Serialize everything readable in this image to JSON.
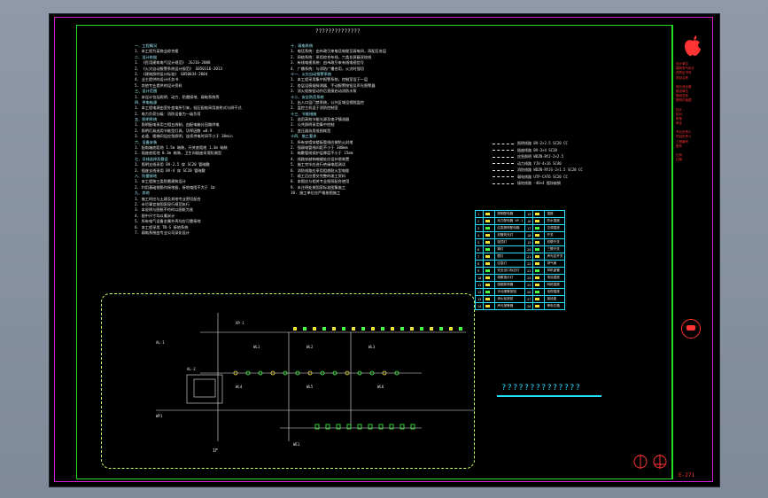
{
  "drawing": {
    "title": "??????????????",
    "sub_title": "??????????????",
    "scale_mark": "1F",
    "sheet_number": "E-271",
    "stamp_text": "TBD"
  },
  "notes_left": [
    "一、工程概况",
    "1. 本工程为某商业综合楼",
    "二、设计依据",
    "1. 《民用建筑电气设计规范》 JGJ16-2008",
    "2. 《火灾自动报警系统设计规范》 GB50116-2013",
    "3. 《建筑照明设计标准》 GB50034-2004",
    "4. 业主提供的设计任务书",
    "5. 其他专业提供的设计资料",
    "三、设计范围",
    "1. 本设计包括照明、动力、防雷接地、弱电系统等",
    "四、供电电源",
    "1. 本工程电源由室外变电所引来，低压配电采用放射式与树干式",
    "2. 电力负荷分级：消防设备为一级负荷",
    "五、照明系统",
    "1. 照明配电采用三相五线制，由配电箱分回路供电",
    "2. 照明灯具选用节能型灯具，功率因数 ≥0.9",
    "3. 走道、楼梯间设应急照明，连续供电时间不小于 30min",
    "六、设备安装",
    "1. 配电箱底距地 1.5m 暗装，开关底距地 1.3m 暗装",
    "2. 插座底距地 0.3m 暗装，卫生间插座采用防溅型",
    "七、导线选择及敷设",
    "1. 照明支线采用 BV-2.5 穿 SC20 管暗敷",
    "2. 插座支线采用 BV-4 穿 SC20 管暗敷",
    "八、防雷接地",
    "1. 本工程按三类防雷建筑设计",
    "2. 利用基础钢筋作接地极，接地电阻不大于 1Ω",
    "九、其他",
    "1. 施工时应与土建及其他专业密切配合",
    "2. 未尽事宜按国家现行规范执行",
    "3. 本说明与图纸不符时以图纸为准",
    "4. 图中尺寸均以毫米计",
    "5. 所有电气设备金属外壳均应可靠接地",
    "6. 本工程采用 TN-S 接地系统",
    "7. 弱电系统由专业公司深化设计"
  ],
  "notes_right": [
    "十、弱电系统",
    "1. 电话系统：由市政引来电话电缆至弱电间，再配至各层",
    "2. 网络系统：采用综合布线，六类非屏蔽双绞线",
    "3. 有线电视系统：由市政引来有线电视信号",
    "4. 广播系统：与消防广播合用，火灾时强切",
    "十一、火灾自动报警系统",
    "1. 本工程采用集中报警系统，控制室设于一层",
    "2. 各层设感烟探测器、手动报警按钮及声光报警器",
    "3. 消火栓按钮动作后直接启动消防水泵",
    "十二、安全防范系统",
    "1. 出入口设门禁系统，公共区域设视频监控",
    "2. 监控主机设于消防控制室",
    "十三、节能措施",
    "1. 选用高效节能光源及电子镇流器",
    "2. 公共照明采用集中控制",
    "3. 变压器选用低损耗型",
    "十四、施工要求",
    "1. 所有穿墙穿楼板管线应做防火封堵",
    "2. 强弱电管线间距不小于 300mm",
    "3. 暗敷管线保护层厚度不小于 15mm",
    "4. 线路穿越伸缩缝处应设补偿装置",
    "5. 施工完毕应进行绝缘电阻测试",
    "6. 消防线路应采用阻燃耐火型电缆",
    "7. 竣工后应提交完整的竣工资料",
    "8. 本图应与相关专业图纸配合使用",
    "9. 未注明处按国家标准图集施工",
    "10. 施工单位应严格按图施工"
  ],
  "legend_lines": [
    "照明线路 BV-2×2.5 SC20 CC",
    "插座线路 BV-3×4 SC20",
    "应急照明 WDZN-BYJ-2×2.5",
    "动力线路 YJV-4×16 SC40",
    "消防线路 WDZN-RYJS-2×1.5 SC20 CC",
    "弱电线路 UTP-CAT6 SC20 CC",
    "接地线路 -40×4 镀锌扁钢"
  ],
  "symbol_table": [
    [
      "1",
      "照明配电箱",
      "15",
      "插座"
    ],
    [
      "2",
      "动力配电箱 AP-1",
      "16",
      "防水插座"
    ],
    [
      "3",
      "应急照明配电箱",
      "17",
      "空调插座"
    ],
    [
      "4",
      "双管荧光灯",
      "18",
      "开关"
    ],
    [
      "5",
      "吸顶灯",
      "19",
      "双联开关"
    ],
    [
      "6",
      "筒灯",
      "20",
      "三联开关"
    ],
    [
      "7",
      "壁灯",
      "21",
      "声光控开关"
    ],
    [
      "8",
      "应急灯",
      "22",
      "排气扇"
    ],
    [
      "9",
      "安全出口标志灯",
      "23",
      "风机盘管"
    ],
    [
      "10",
      "疏散指示灯",
      "24",
      "电话插座"
    ],
    [
      "11",
      "感烟探测器",
      "25",
      "网络插座"
    ],
    [
      "12",
      "手动报警按钮",
      "26",
      "电视插座"
    ],
    [
      "13",
      "消火栓按钮",
      "27",
      "接线盒"
    ],
    [
      "14",
      "声光报警器",
      "28",
      "等电位箱"
    ]
  ],
  "diagram_labels": [
    "AL-1",
    "AL-2",
    "AP-1",
    "WL1",
    "WL2",
    "WL3",
    "WL4",
    "WL5",
    "WL6",
    "WP1",
    "WE1"
  ],
  "title_block_lines": [
    "设计单位",
    "建筑电气设计",
    "资质证书号",
    "项目名称",
    "商业综合楼",
    "建设单位",
    "图纸名称",
    "照明平面图",
    "设计",
    "校对",
    "审核",
    "审定",
    "专业负责人",
    "项目负责人",
    "工程编号",
    "图号",
    "比例",
    "日期"
  ],
  "colors": {
    "frame": "#22dd22",
    "sheet_border": "#d020d0",
    "text_primary": "#e8e8e8",
    "accent_cyan": "#22e0ff",
    "title_red": "#ff3333",
    "symbol_yellow": "#f3e23a",
    "cloud": "#c8ff6a"
  }
}
